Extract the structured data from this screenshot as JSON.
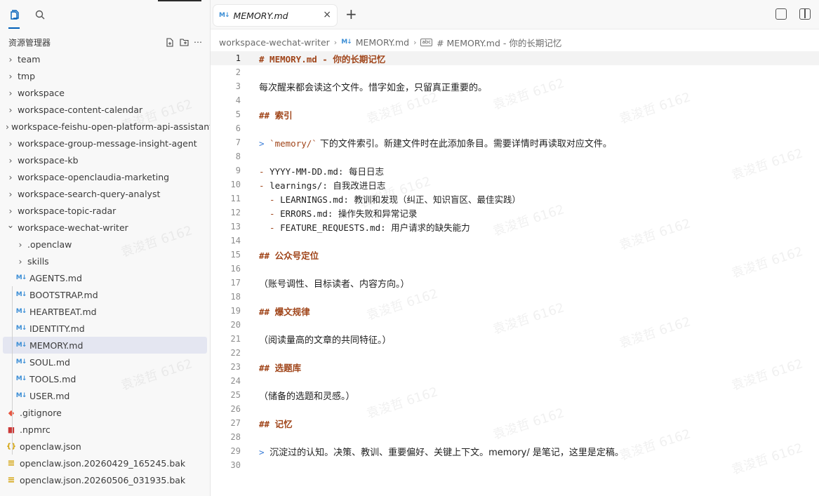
{
  "sidebar": {
    "title": "资源管理器",
    "tree": [
      {
        "label": "team",
        "type": "folder",
        "indent": 0,
        "expanded": false
      },
      {
        "label": "tmp",
        "type": "folder",
        "indent": 0,
        "expanded": false
      },
      {
        "label": "workspace",
        "type": "folder",
        "indent": 0,
        "expanded": false
      },
      {
        "label": "workspace-content-calendar",
        "type": "folder",
        "indent": 0,
        "expanded": false
      },
      {
        "label": "workspace-feishu-open-platform-api-assistant",
        "type": "folder",
        "indent": 0,
        "expanded": false
      },
      {
        "label": "workspace-group-message-insight-agent",
        "type": "folder",
        "indent": 0,
        "expanded": false
      },
      {
        "label": "workspace-kb",
        "type": "folder",
        "indent": 0,
        "expanded": false
      },
      {
        "label": "workspace-openclaudia-marketing",
        "type": "folder",
        "indent": 0,
        "expanded": false
      },
      {
        "label": "workspace-search-query-analyst",
        "type": "folder",
        "indent": 0,
        "expanded": false
      },
      {
        "label": "workspace-topic-radar",
        "type": "folder",
        "indent": 0,
        "expanded": false
      },
      {
        "label": "workspace-wechat-writer",
        "type": "folder",
        "indent": 0,
        "expanded": true
      },
      {
        "label": ".openclaw",
        "type": "folder",
        "indent": 1,
        "expanded": false
      },
      {
        "label": "skills",
        "type": "folder",
        "indent": 1,
        "expanded": false
      },
      {
        "label": "AGENTS.md",
        "type": "md",
        "indent": 1
      },
      {
        "label": "BOOTSTRAP.md",
        "type": "md",
        "indent": 1
      },
      {
        "label": "HEARTBEAT.md",
        "type": "md",
        "indent": 1
      },
      {
        "label": "IDENTITY.md",
        "type": "md",
        "indent": 1
      },
      {
        "label": "MEMORY.md",
        "type": "md",
        "indent": 1,
        "selected": true
      },
      {
        "label": "SOUL.md",
        "type": "md",
        "indent": 1
      },
      {
        "label": "TOOLS.md",
        "type": "md",
        "indent": 1
      },
      {
        "label": "USER.md",
        "type": "md",
        "indent": 1
      },
      {
        "label": ".gitignore",
        "type": "git",
        "indent": 0
      },
      {
        "label": ".npmrc",
        "type": "npm",
        "indent": 0
      },
      {
        "label": "openclaw.json",
        "type": "json",
        "indent": 0
      },
      {
        "label": "openclaw.json.20260429_165245.bak",
        "type": "bak",
        "indent": 0
      },
      {
        "label": "openclaw.json.20260506_031935.bak",
        "type": "bak",
        "indent": 0
      }
    ]
  },
  "tab": {
    "label": "MEMORY.md",
    "close": "×",
    "add": "+"
  },
  "breadcrumbs": {
    "folder": "workspace-wechat-writer",
    "file": "MEMORY.md",
    "symbol": "# MEMORY.md - 你的长期记忆",
    "md_badge": "M↓",
    "symbol_badge": "abc"
  },
  "editor": {
    "current_line": 1,
    "lines": [
      {
        "n": "1",
        "text": "# MEMORY.md - 你的长期记忆",
        "kind": "h"
      },
      {
        "n": "2",
        "text": "",
        "kind": "p"
      },
      {
        "n": "3",
        "text": "每次醒来都会读这个文件。惜字如金，只留真正重要的。",
        "kind": "p"
      },
      {
        "n": "4",
        "text": "",
        "kind": "p"
      },
      {
        "n": "5",
        "text": "## 索引",
        "kind": "h"
      },
      {
        "n": "6",
        "text": "",
        "kind": "p"
      },
      {
        "n": "7",
        "text": "",
        "kind": "bq-code",
        "marker": "> ",
        "code": "`memory/`",
        "rest": " 下的文件索引。新建文件时在此添加条目。需要详情时再读取对应文件。"
      },
      {
        "n": "8",
        "text": "",
        "kind": "p"
      },
      {
        "n": "9",
        "text": "",
        "kind": "li",
        "marker": "- ",
        "rest": "YYYY-MM-DD.md: 每日日志"
      },
      {
        "n": "10",
        "text": "",
        "kind": "li",
        "marker": "- ",
        "rest": "learnings/: 自我改进日志"
      },
      {
        "n": "11",
        "text": "",
        "kind": "li",
        "marker": "  - ",
        "rest": "LEARNINGS.md: 教训和发现（纠正、知识盲区、最佳实践）"
      },
      {
        "n": "12",
        "text": "",
        "kind": "li",
        "marker": "  - ",
        "rest": "ERRORS.md: 操作失败和异常记录"
      },
      {
        "n": "13",
        "text": "",
        "kind": "li",
        "marker": "  - ",
        "rest": "FEATURE_REQUESTS.md: 用户请求的缺失能力"
      },
      {
        "n": "14",
        "text": "",
        "kind": "p"
      },
      {
        "n": "15",
        "text": "## 公众号定位",
        "kind": "h"
      },
      {
        "n": "16",
        "text": "",
        "kind": "p"
      },
      {
        "n": "17",
        "text": "（账号调性、目标读者、内容方向。）",
        "kind": "p"
      },
      {
        "n": "18",
        "text": "",
        "kind": "p"
      },
      {
        "n": "19",
        "text": "## 爆文规律",
        "kind": "h"
      },
      {
        "n": "20",
        "text": "",
        "kind": "p"
      },
      {
        "n": "21",
        "text": "（阅读量高的文章的共同特征。）",
        "kind": "p"
      },
      {
        "n": "22",
        "text": "",
        "kind": "p"
      },
      {
        "n": "23",
        "text": "## 选题库",
        "kind": "h"
      },
      {
        "n": "24",
        "text": "",
        "kind": "p"
      },
      {
        "n": "25",
        "text": "（储备的选题和灵感。）",
        "kind": "p"
      },
      {
        "n": "26",
        "text": "",
        "kind": "p"
      },
      {
        "n": "27",
        "text": "## 记忆",
        "kind": "h"
      },
      {
        "n": "28",
        "text": "",
        "kind": "p"
      },
      {
        "n": "29",
        "text": "",
        "kind": "bq",
        "marker": "> ",
        "rest": "沉淀过的认知。决策、教训、重要偏好、关键上下文。memory/ 是笔记，这里是定稿。"
      },
      {
        "n": "30",
        "text": "",
        "kind": "p"
      }
    ]
  },
  "watermark": "袁浚哲 6162",
  "colors": {
    "heading": "#a0451a",
    "blockquote": "#3b7dd8",
    "accent": "#005fb8",
    "md_icon": "#3d8fd6"
  },
  "icons": {
    "explorer": "files-icon",
    "search": "search-icon",
    "new_file": "new-file-icon",
    "new_folder": "new-folder-icon",
    "more": "ellipsis-icon",
    "layout": "layout-icon",
    "split": "split-editor-icon"
  }
}
